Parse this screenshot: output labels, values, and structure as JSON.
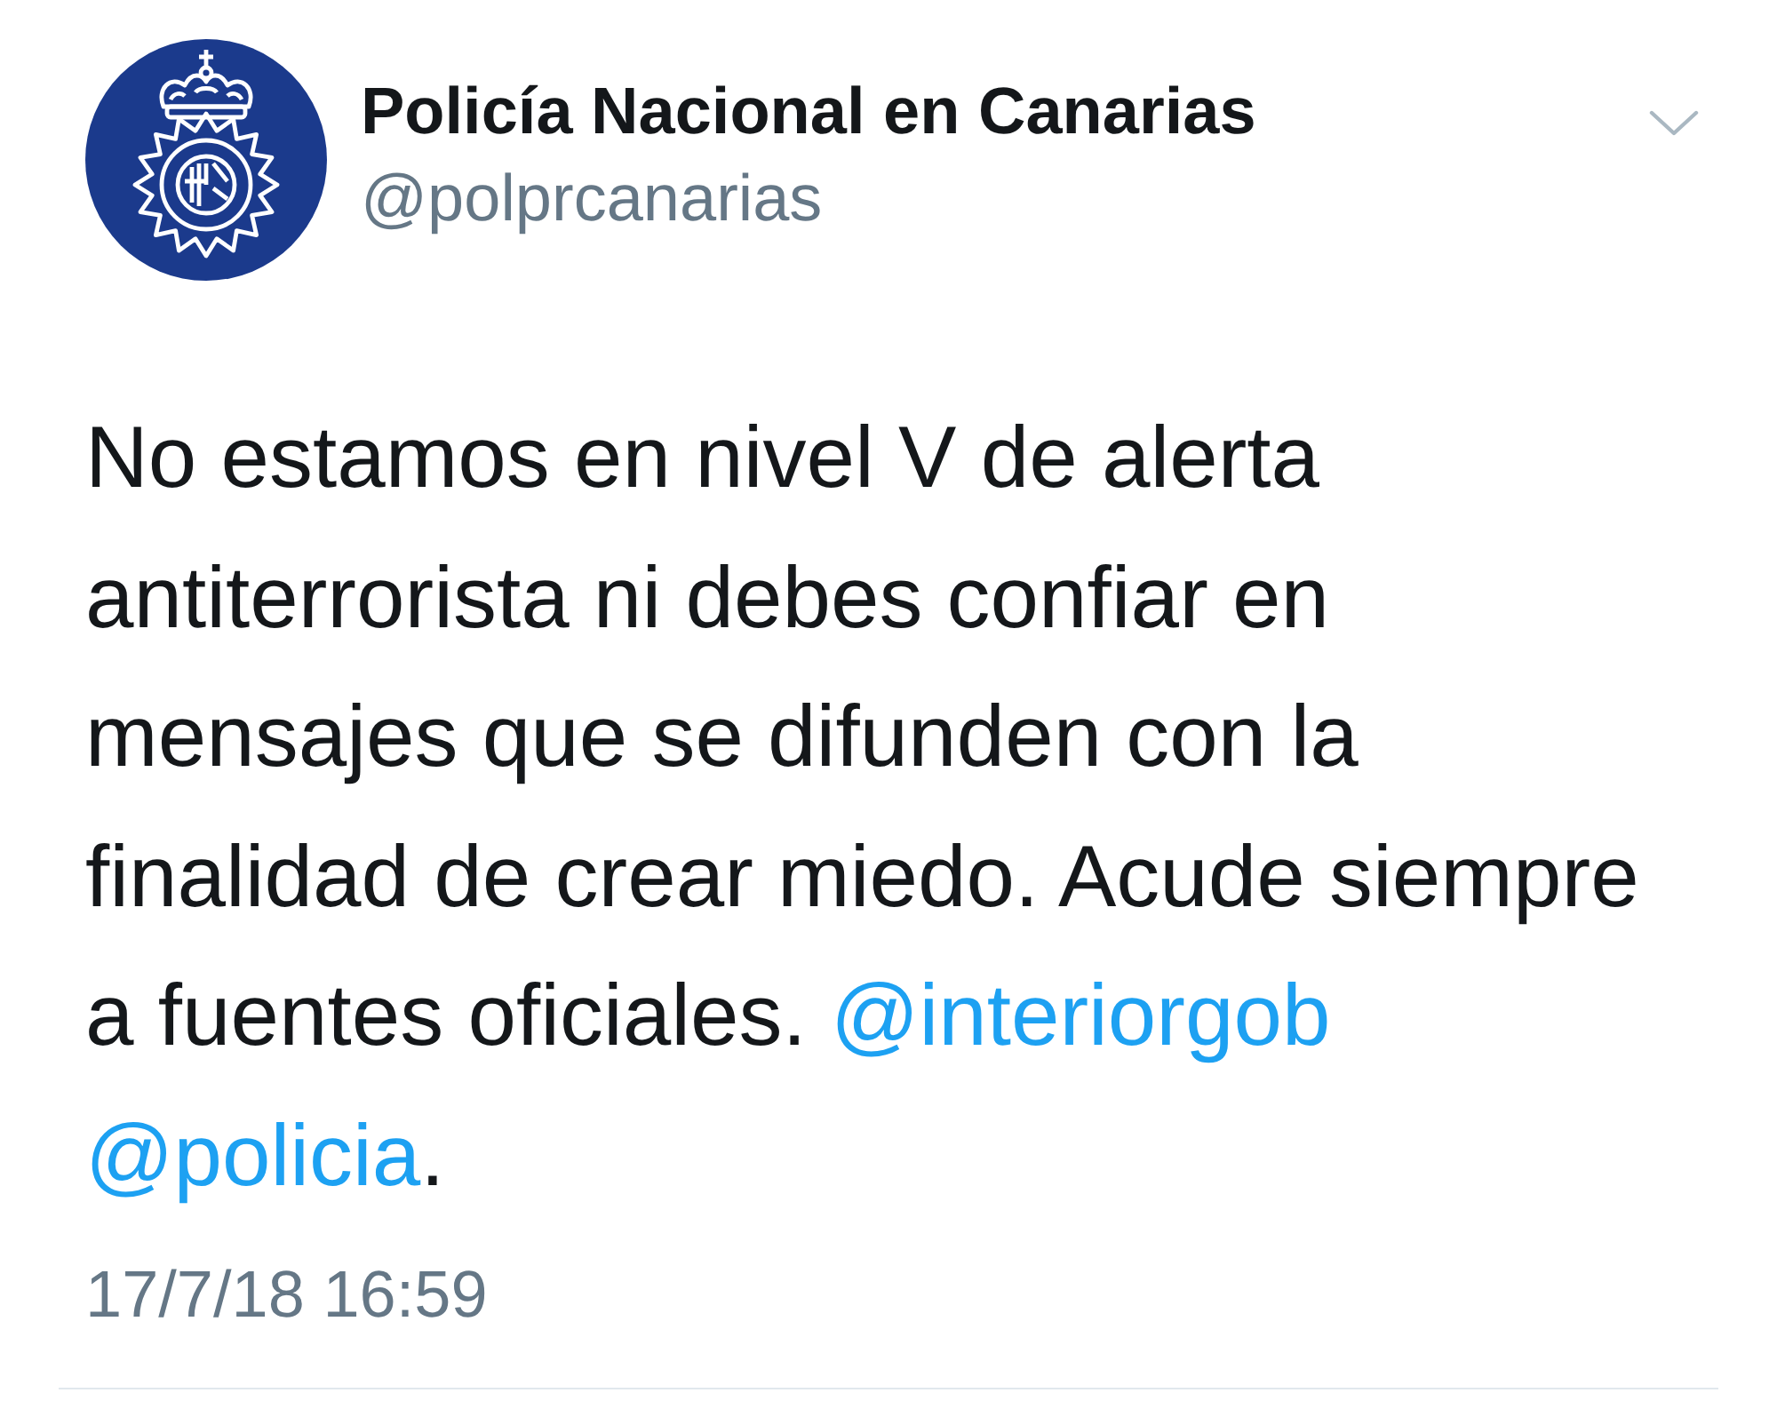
{
  "tweet": {
    "author": {
      "name": "Policía Nacional en Canarias",
      "handle": "@polprcanarias"
    },
    "body": [
      {
        "kind": "text",
        "text": "No estamos en nivel V de alerta antiterrorista ni debes confiar en mensajes que se difunden con la finalidad de crear miedo. Acude siempre a fuentes oficiales."
      },
      {
        "kind": "mention",
        "text": "@interiorgob"
      },
      {
        "kind": "mention",
        "text": "@policia"
      },
      {
        "kind": "text",
        "text": "."
      }
    ],
    "timestamp": "17/7/18 16:59"
  }
}
